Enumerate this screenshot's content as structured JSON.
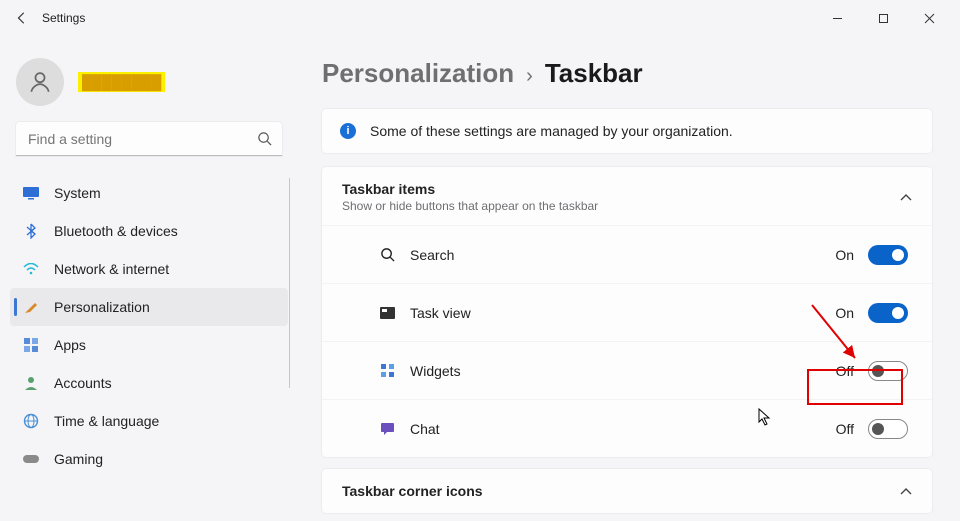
{
  "window": {
    "app_title": "Settings"
  },
  "user": {
    "name_redacted": "████████"
  },
  "search": {
    "placeholder": "Find a setting"
  },
  "sidebar": {
    "items": [
      {
        "label": "System"
      },
      {
        "label": "Bluetooth & devices"
      },
      {
        "label": "Network & internet"
      },
      {
        "label": "Personalization"
      },
      {
        "label": "Apps"
      },
      {
        "label": "Accounts"
      },
      {
        "label": "Time & language"
      },
      {
        "label": "Gaming"
      }
    ],
    "selected_index": 3
  },
  "breadcrumb": {
    "parent": "Personalization",
    "current": "Taskbar"
  },
  "banner": {
    "text": "Some of these settings are managed by your organization."
  },
  "section": {
    "title": "Taskbar items",
    "subtitle": "Show or hide buttons that appear on the taskbar",
    "rows": [
      {
        "label": "Search",
        "state": "On",
        "on": true
      },
      {
        "label": "Task view",
        "state": "On",
        "on": true
      },
      {
        "label": "Widgets",
        "state": "Off",
        "on": false
      },
      {
        "label": "Chat",
        "state": "Off",
        "on": false
      }
    ]
  },
  "section2": {
    "title": "Taskbar corner icons"
  },
  "annotation": {
    "highlight_row_index": 2,
    "colors": {
      "highlight": "#e10000",
      "accent": "#0a63c9"
    }
  }
}
